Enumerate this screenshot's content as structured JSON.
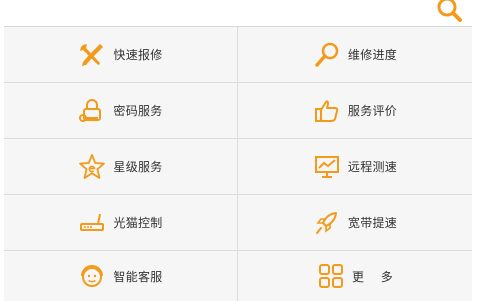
{
  "accent_color": "#f29a1a",
  "header": {
    "search_icon": "search-icon"
  },
  "services": [
    {
      "label": "快速报修",
      "icon": "wrench-screwdriver-icon"
    },
    {
      "label": "维修进度",
      "icon": "magnifier-icon"
    },
    {
      "label": "密码服务",
      "icon": "key-lock-icon"
    },
    {
      "label": "服务评价",
      "icon": "thumbs-up-icon"
    },
    {
      "label": "星级服务",
      "icon": "star-e-icon"
    },
    {
      "label": "远程测速",
      "icon": "speed-monitor-icon"
    },
    {
      "label": "光猫控制",
      "icon": "modem-router-icon"
    },
    {
      "label": "宽带提速",
      "icon": "rocket-icon"
    },
    {
      "label": "智能客服",
      "icon": "customer-service-avatar-icon"
    },
    {
      "label": "更    多",
      "icon": "more-grid-icon"
    }
  ]
}
